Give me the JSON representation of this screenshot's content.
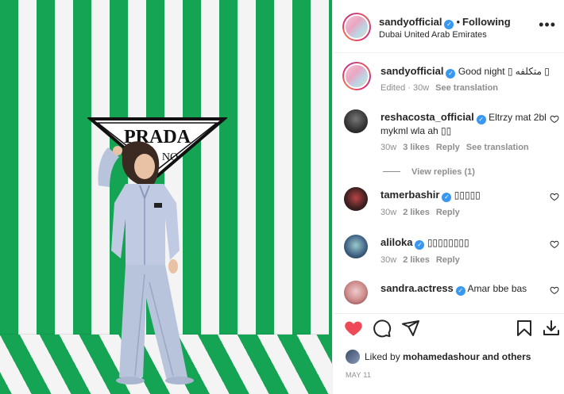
{
  "post": {
    "author": "sandyofficial",
    "follow_status": "Following",
    "location": "Dubai United Arab Emirates",
    "more_label": "•••",
    "caption_text": "Good night ▯ متكلفه ▯",
    "caption_meta": "Edited · 30w",
    "caption_translate": "See translation",
    "photo_logo_text": "PRADA",
    "photo_logo_sub": "NO",
    "date": "MAY 11"
  },
  "comments": [
    {
      "user": "reshacosta_official",
      "text_line1": "Eltrzy mat 2bl",
      "text_line2": "mykml wla ah ▯▯",
      "age": "30w",
      "likes": "3 likes",
      "reply": "Reply",
      "translate": "See translation",
      "view_replies": "View replies (1)"
    },
    {
      "user": "tamerbashir",
      "text_line1": "▯▯▯▯▯",
      "age": "30w",
      "likes": "2 likes",
      "reply": "Reply"
    },
    {
      "user": "aliloka",
      "text_line1": "▯▯▯▯▯▯▯▯",
      "age": "30w",
      "likes": "2 likes",
      "reply": "Reply"
    },
    {
      "user": "sandra.actress",
      "text_line1": "Amar bbe bas"
    }
  ],
  "likes": {
    "prefix": "Liked by",
    "user": "mohamedashour",
    "suffix": "and others"
  },
  "icons": {
    "like": "heart-filled-icon",
    "comment": "comment-icon",
    "share": "share-icon",
    "save": "bookmark-icon",
    "download": "download-icon",
    "verified": "verified-badge-icon",
    "more": "more-options-icon"
  },
  "colors": {
    "like_red": "#ed4956",
    "verified_blue": "#3897f0",
    "stripe_green": "#14a454",
    "muted_text": "#8e8e8e"
  }
}
